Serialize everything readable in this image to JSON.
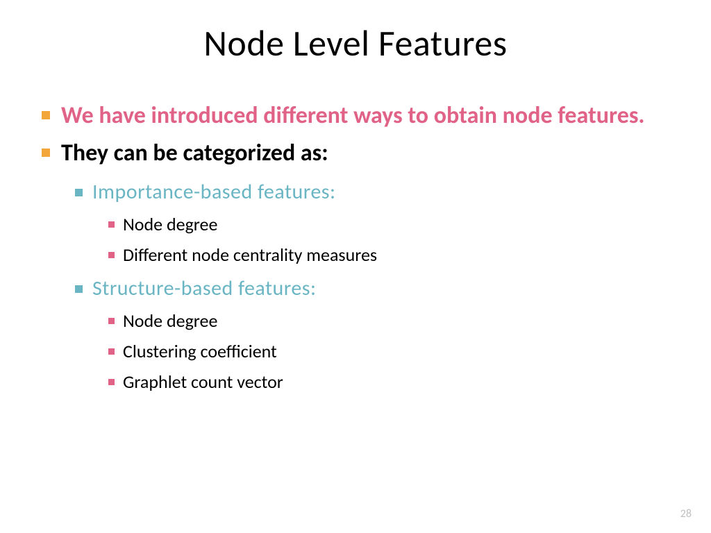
{
  "title": "Node Level Features",
  "bullets": {
    "b1": "We have introduced different ways to obtain node features.",
    "b2": "They can be categorized as:",
    "b2_1": "Importance-based features:",
    "b2_1_1": "Node degree",
    "b2_1_2": "Different node centrality measures",
    "b2_2": "Structure-based  features:",
    "b2_2_1": "Node degree",
    "b2_2_2": "Clustering coefficient",
    "b2_2_3": "Graphlet count vector"
  },
  "pageNumber": "28"
}
